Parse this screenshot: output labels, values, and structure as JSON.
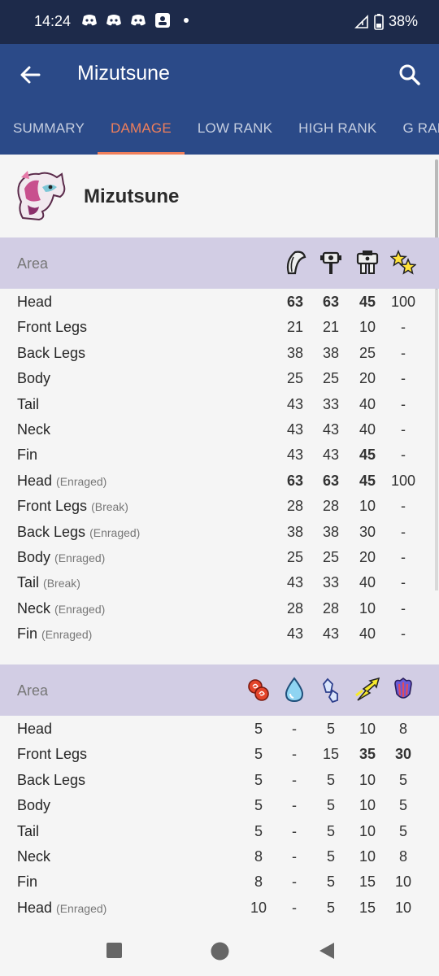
{
  "status": {
    "time": "14:24",
    "battery": "38%"
  },
  "app": {
    "title": "Mizutsune"
  },
  "tabs": [
    "SUMMARY",
    "DAMAGE",
    "LOW RANK",
    "HIGH RANK",
    "G RANK"
  ],
  "monster": {
    "name": "Mizutsune"
  },
  "physical": {
    "header": "Area",
    "icons": [
      "cut-icon",
      "impact-icon",
      "shot-icon",
      "stun-icon"
    ],
    "rows": [
      {
        "name": "Head",
        "sub": "",
        "vals": [
          "63",
          "63",
          "45",
          "100"
        ],
        "bold": [
          true,
          true,
          true,
          false
        ]
      },
      {
        "name": "Front Legs",
        "sub": "",
        "vals": [
          "21",
          "21",
          "10",
          "-"
        ],
        "bold": [
          false,
          false,
          false,
          false
        ]
      },
      {
        "name": "Back Legs",
        "sub": "",
        "vals": [
          "38",
          "38",
          "25",
          "-"
        ],
        "bold": [
          false,
          false,
          false,
          false
        ]
      },
      {
        "name": "Body",
        "sub": "",
        "vals": [
          "25",
          "25",
          "20",
          "-"
        ],
        "bold": [
          false,
          false,
          false,
          false
        ]
      },
      {
        "name": "Tail",
        "sub": "",
        "vals": [
          "43",
          "33",
          "40",
          "-"
        ],
        "bold": [
          false,
          false,
          false,
          false
        ]
      },
      {
        "name": "Neck",
        "sub": "",
        "vals": [
          "43",
          "43",
          "40",
          "-"
        ],
        "bold": [
          false,
          false,
          false,
          false
        ]
      },
      {
        "name": "Fin",
        "sub": "",
        "vals": [
          "43",
          "43",
          "45",
          "-"
        ],
        "bold": [
          false,
          false,
          true,
          false
        ]
      },
      {
        "name": "Head",
        "sub": "(Enraged)",
        "vals": [
          "63",
          "63",
          "45",
          "100"
        ],
        "bold": [
          true,
          true,
          true,
          false
        ]
      },
      {
        "name": "Front Legs",
        "sub": "(Break)",
        "vals": [
          "28",
          "28",
          "10",
          "-"
        ],
        "bold": [
          false,
          false,
          false,
          false
        ]
      },
      {
        "name": "Back Legs",
        "sub": "(Enraged)",
        "vals": [
          "38",
          "38",
          "30",
          "-"
        ],
        "bold": [
          false,
          false,
          false,
          false
        ]
      },
      {
        "name": "Body",
        "sub": "(Enraged)",
        "vals": [
          "25",
          "25",
          "20",
          "-"
        ],
        "bold": [
          false,
          false,
          false,
          false
        ]
      },
      {
        "name": "Tail",
        "sub": "(Break)",
        "vals": [
          "43",
          "33",
          "40",
          "-"
        ],
        "bold": [
          false,
          false,
          false,
          false
        ]
      },
      {
        "name": "Neck",
        "sub": "(Enraged)",
        "vals": [
          "28",
          "28",
          "10",
          "-"
        ],
        "bold": [
          false,
          false,
          false,
          false
        ]
      },
      {
        "name": "Fin",
        "sub": "(Enraged)",
        "vals": [
          "43",
          "43",
          "40",
          "-"
        ],
        "bold": [
          false,
          false,
          false,
          false
        ]
      }
    ]
  },
  "elemental": {
    "header": "Area",
    "icons": [
      "fire-icon",
      "water-icon",
      "ice-icon",
      "thunder-icon",
      "dragon-icon"
    ],
    "rows": [
      {
        "name": "Head",
        "sub": "",
        "vals": [
          "5",
          "-",
          "5",
          "10",
          "8"
        ],
        "bold": [
          false,
          false,
          false,
          false,
          false
        ]
      },
      {
        "name": "Front Legs",
        "sub": "",
        "vals": [
          "5",
          "-",
          "15",
          "35",
          "30"
        ],
        "bold": [
          false,
          false,
          false,
          true,
          true
        ]
      },
      {
        "name": "Back Legs",
        "sub": "",
        "vals": [
          "5",
          "-",
          "5",
          "10",
          "5"
        ],
        "bold": [
          false,
          false,
          false,
          false,
          false
        ]
      },
      {
        "name": "Body",
        "sub": "",
        "vals": [
          "5",
          "-",
          "5",
          "10",
          "5"
        ],
        "bold": [
          false,
          false,
          false,
          false,
          false
        ]
      },
      {
        "name": "Tail",
        "sub": "",
        "vals": [
          "5",
          "-",
          "5",
          "10",
          "5"
        ],
        "bold": [
          false,
          false,
          false,
          false,
          false
        ]
      },
      {
        "name": "Neck",
        "sub": "",
        "vals": [
          "8",
          "-",
          "5",
          "10",
          "8"
        ],
        "bold": [
          false,
          false,
          false,
          false,
          false
        ]
      },
      {
        "name": "Fin",
        "sub": "",
        "vals": [
          "8",
          "-",
          "5",
          "15",
          "10"
        ],
        "bold": [
          false,
          false,
          false,
          false,
          false
        ]
      },
      {
        "name": "Head",
        "sub": "(Enraged)",
        "vals": [
          "10",
          "-",
          "5",
          "15",
          "10"
        ],
        "bold": [
          false,
          false,
          false,
          false,
          false
        ]
      }
    ]
  }
}
